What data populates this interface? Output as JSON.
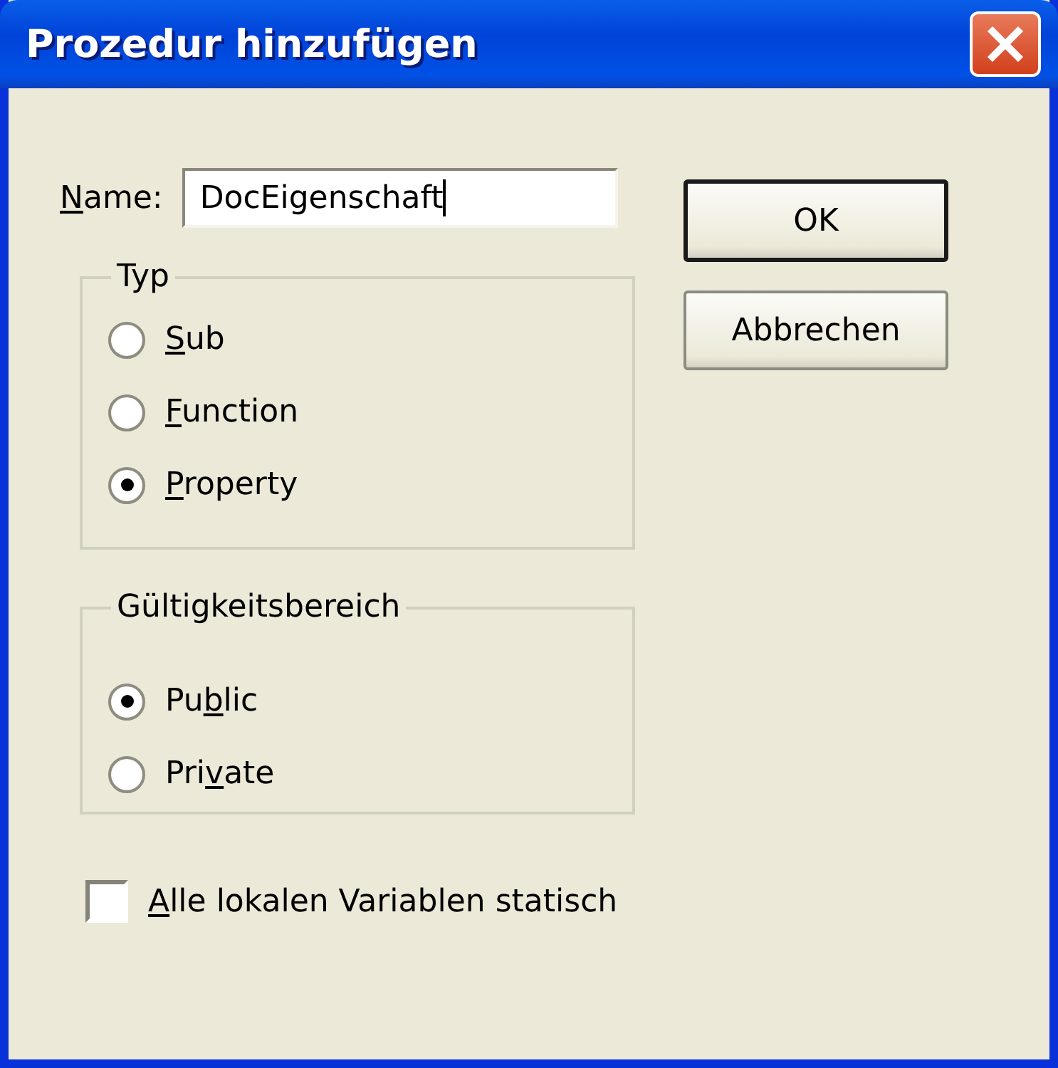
{
  "window": {
    "title": "Prozedur hinzufügen"
  },
  "name_field": {
    "label": [
      {
        "text": "N",
        "underline": true
      },
      {
        "text": "ame:",
        "underline": false
      }
    ],
    "value": "DocEigenschaft"
  },
  "buttons": [
    {
      "label": "OK",
      "default": true
    },
    {
      "label": "Abbrechen",
      "default": false
    }
  ],
  "groups": [
    {
      "title": "Typ",
      "options": [
        {
          "label": [
            {
              "text": "S",
              "underline": true
            },
            {
              "text": "ub",
              "underline": false
            }
          ],
          "selected": false
        },
        {
          "label": [
            {
              "text": "F",
              "underline": true
            },
            {
              "text": "unction",
              "underline": false
            }
          ],
          "selected": false
        },
        {
          "label": [
            {
              "text": "P",
              "underline": true
            },
            {
              "text": "roperty",
              "underline": false
            }
          ],
          "selected": true
        }
      ]
    },
    {
      "title": "Gültigkeitsbereich",
      "options": [
        {
          "label": [
            {
              "text": "Pu",
              "underline": false
            },
            {
              "text": "b",
              "underline": true
            },
            {
              "text": "lic",
              "underline": false
            }
          ],
          "selected": true
        },
        {
          "label": [
            {
              "text": "Pri",
              "underline": false
            },
            {
              "text": "v",
              "underline": true
            },
            {
              "text": "ate",
              "underline": false
            }
          ],
          "selected": false
        }
      ]
    }
  ],
  "checkbox": {
    "label": [
      {
        "text": "A",
        "underline": true
      },
      {
        "text": "lle lokalen Variablen statisch",
        "underline": false
      }
    ],
    "checked": false
  }
}
